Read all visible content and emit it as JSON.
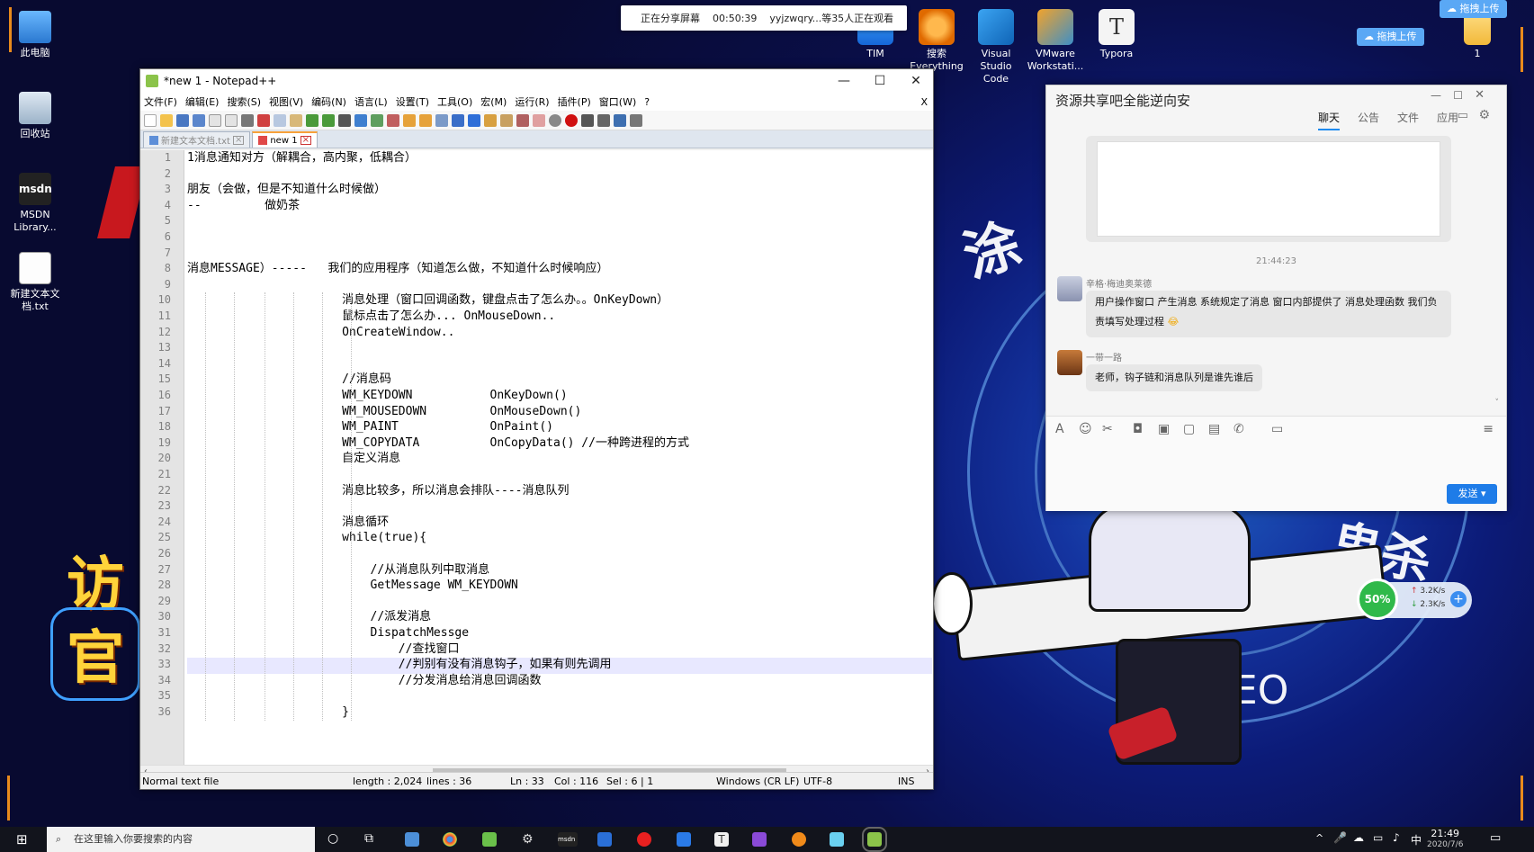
{
  "desktop": {
    "icons": [
      {
        "label": "此电脑"
      },
      {
        "label": "回收站"
      },
      {
        "label": "MSDN Library..."
      },
      {
        "label": "新建文本文档.txt"
      }
    ],
    "top_icons": [
      {
        "label": "TIM"
      },
      {
        "label": "搜索 Everything"
      },
      {
        "label": "Visual Studio Code"
      },
      {
        "label": "VMware Workstati..."
      },
      {
        "label": "Typora"
      },
      {
        "label": "1"
      }
    ],
    "upload_top": "拖拽上传",
    "upload_mid": "拖拽上传",
    "bg_words": [
      "涂",
      "鬼杀",
      "SEO",
      "访",
      "官"
    ]
  },
  "share_bar": {
    "status": "正在分享屏幕",
    "elapsed": "00:50:39",
    "viewers": "yyjzwqry...等35人正在观看"
  },
  "notepad": {
    "title": "*new 1 - Notepad++",
    "min_label": "—",
    "max_label": "☐",
    "close_label": "✕",
    "doc_close": "X",
    "menu": [
      "文件(F)",
      "编辑(E)",
      "搜索(S)",
      "视图(V)",
      "编码(N)",
      "语言(L)",
      "设置(T)",
      "工具(O)",
      "宏(M)",
      "运行(R)",
      "插件(P)",
      "窗口(W)",
      "?"
    ],
    "tabs": [
      {
        "label": "新建文本文档.txt",
        "active": false
      },
      {
        "label": "new 1",
        "active": true
      }
    ],
    "lines": [
      "1消息通知对方（解耦合，高内聚，低耦合）",
      "",
      "朋友（会做，但是不知道什么时候做）",
      "--         做奶茶",
      "",
      "",
      "",
      "消息MESSAGE）-----   我们的应用程序（知道怎么做，不知道什么时候响应）",
      "",
      "                      消息处理（窗口回调函数，键盘点击了怎么办。。OnKeyDown）",
      "                      鼠标点击了怎么办... OnMouseDown..",
      "                      OnCreateWindow..",
      "",
      "",
      "                      //消息码",
      "                      WM_KEYDOWN           OnKeyDown()",
      "                      WM_MOUSEDOWN         OnMouseDown()",
      "                      WM_PAINT             OnPaint()",
      "                      WM_COPYDATA          OnCopyData() //一种跨进程的方式",
      "                      自定义消息",
      "",
      "                      消息比较多，所以消息会排队----消息队列",
      "",
      "                      消息循环",
      "                      while(true){",
      "",
      "                          //从消息队列中取消息",
      "                          GetMessage WM_KEYDOWN",
      "",
      "                          //派发消息",
      "                          DispatchMessge",
      "                              //查找窗口",
      "                              //判别有没有消息钩子，如果有则先调用",
      "                              //分发消息给消息回调函数",
      "",
      "                      }"
    ],
    "line_numbers": [
      "1",
      "2",
      "3",
      "4",
      "5",
      "6",
      "7",
      "8",
      "9",
      "10",
      "11",
      "12",
      "13",
      "14",
      "15",
      "16",
      "17",
      "18",
      "19",
      "20",
      "21",
      "22",
      "23",
      "24",
      "25",
      "26",
      "27",
      "28",
      "29",
      "30",
      "31",
      "32",
      "33",
      "34",
      "35",
      "36"
    ],
    "status": {
      "type": "Normal text file",
      "length": "length : 2,024",
      "lines": "lines : 36",
      "ln": "Ln : 33",
      "col": "Col : 116",
      "sel": "Sel : 6 | 1",
      "eol": "Windows (CR LF)",
      "enc": "UTF-8",
      "mode": "INS"
    }
  },
  "chat": {
    "title": "资源共享吧全能逆向安",
    "tabs": [
      "聊天",
      "公告",
      "文件",
      "应用"
    ],
    "time": "21:44:23",
    "messages": [
      {
        "sender": "辛格·梅迪奥莱德",
        "text": "用户操作窗口 产生消息 系统规定了消息 窗口内部提供了 消息处理函数 我们负责填写处理过程"
      },
      {
        "sender": "一带一路",
        "text": "老师，钩子链和消息队列是谁先谁后"
      }
    ],
    "send": "发送"
  },
  "net_widget": {
    "percent": "50%",
    "up": "3.2K/s",
    "down": "2.3K/s"
  },
  "taskbar": {
    "search_placeholder": "在这里输入你要搜索的内容",
    "time": "21:49",
    "date": "2020/7/6",
    "ime": "中"
  }
}
